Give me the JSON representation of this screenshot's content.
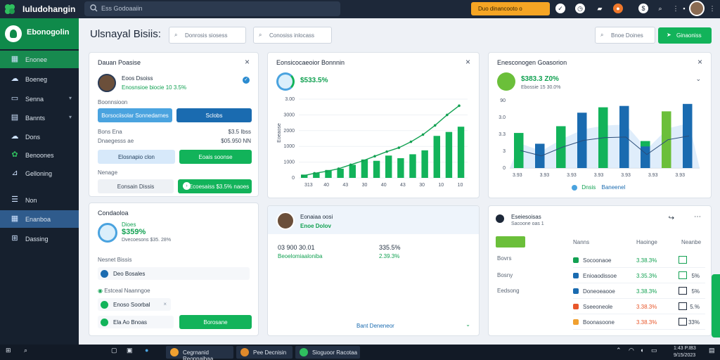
{
  "app": {
    "title": "Iuludohangin"
  },
  "topbar": {
    "search_placeholder": "Ess Godoaaiin",
    "promo_label": "Duo dinancooto o",
    "icons": [
      "check-icon",
      "clock-icon",
      "briefcase-icon",
      "fire-icon",
      "dollar-icon",
      "search-icon",
      "more-icon",
      "person-icon"
    ]
  },
  "sidebar": {
    "workspace": "Ebonogolin",
    "items": [
      {
        "label": "Enonee",
        "icon": "dashboard-icon"
      },
      {
        "label": "Boeneg",
        "icon": "cloud-icon"
      },
      {
        "label": "Senna",
        "icon": "inbox-icon"
      },
      {
        "label": "Bannts",
        "icon": "document-icon"
      },
      {
        "label": "Dons",
        "icon": "cloud-icon"
      },
      {
        "label": "Benoones",
        "icon": "leaf-icon"
      },
      {
        "label": "Gelloning",
        "icon": "bar-chart-icon"
      },
      {
        "label": "Non",
        "icon": "list-icon"
      },
      {
        "label": "Enanboa",
        "icon": "dashboard-icon"
      },
      {
        "label": "Dassing",
        "icon": "cart-icon"
      }
    ]
  },
  "header": {
    "title": "Ulsnayal Bisiis:",
    "filter_one": "Donrosis siosess",
    "filter_two": "Conosiss inlocass",
    "filter_three": "Bnoe Doines",
    "action_label": "Ginaoniss"
  },
  "profile_card": {
    "title": "Dauan Poasise",
    "name": "Eoos Dsoiss",
    "subtitle": "Enosnsioe biocie 10 3.5%",
    "section": "Boonnsioon",
    "btn_primary": "Borsociisolar Sonnedarnes",
    "btn_secondary": "Sclobs",
    "row1_label": "Bons Ena",
    "row1_value": "$3.5 Ibss",
    "row2_label": "Dnaegesss ae",
    "row2_value": "$05.950 NN",
    "btn_light": "Elosnapio clon",
    "btn_green": "Eoais soonse",
    "row3_label": "Nenage",
    "field_label": "Eonsain Dissis",
    "btn_toggle": "Ecoesaiss $3.5% naoes"
  },
  "contacts_card": {
    "title": "Condaoloa",
    "stat_label": "Dioes",
    "stat_value": "$359%",
    "stat_sub": "Dvecoesons $35. 28%",
    "section_one": "Nesnet Bissis",
    "section_two": "Estceal Naanngoe",
    "items": [
      "Deo Bosales",
      "Enoso Soorbal",
      "Ela Ao Bnoas"
    ],
    "btn_green": "Borosane"
  },
  "growth_card": {
    "title": "Eonsicocaeoior Bonnnin",
    "stat": "$533.5%"
  },
  "comparison_card": {
    "title": "Enesconogen Goasorion",
    "stat": "$383.3 Z0%",
    "stat_sub": "Ebossie  15 30.0%",
    "legend": [
      "Dnsis",
      "Baneenel"
    ]
  },
  "user_card": {
    "name": "Eonaiaa oosi",
    "subtitle": "Enoe Dolov",
    "left_value": "03 900 30.01",
    "left_sub": "Beoelomiaaloniba",
    "right_value": "335.5%",
    "right_sub": "2.39.3%",
    "footer": "Bant Deneneor"
  },
  "table_card": {
    "title": "Eseiesoisas",
    "subtitle": "Sacoone oas 1",
    "btn_green": "",
    "side_items": [
      "Bovrs",
      "Bosny",
      "Eedsong"
    ],
    "columns": [
      "Nanns",
      "Haoinge",
      "Neanbe"
    ],
    "rows": [
      {
        "name": "Socoonaoe",
        "change": "3.38.3%",
        "value": ""
      },
      {
        "name": "Enioaodissoe",
        "change": "3.35.3%",
        "value": "5%"
      },
      {
        "name": "Doneoeaooe",
        "change": "3.38.3%",
        "value": "5%"
      },
      {
        "name": "Sseeoneole",
        "change": "3.38.3%",
        "value": "5.%"
      },
      {
        "name": "Boonasoone",
        "change": "3.38.3%",
        "value": "33%"
      }
    ]
  },
  "taskbar": {
    "apps": [
      "Cegrnanid Reopnaibaa",
      "Pee Decnisin",
      "Sioguoor Racotaa"
    ],
    "time": "1:43 P.IB3",
    "date": "9/15/2023"
  },
  "colors": {
    "accent": "#12b35a",
    "sidebar": "#16202e",
    "blue": "#1a6bb0"
  },
  "chart_data": [
    {
      "type": "bar",
      "title": "Eonsicocaeoior Bonnnin",
      "ylabel": "Eoeaose",
      "yticks": [
        "3.00",
        "3000",
        "2000",
        "1000",
        "1000",
        "0"
      ],
      "xticks": [
        "313",
        "40",
        "43",
        "30",
        "40",
        "43",
        "30",
        "10",
        "10"
      ],
      "series": [
        {
          "values": [
            5,
            8,
            12,
            14,
            20,
            28,
            26,
            34,
            30,
            36,
            42,
            64,
            70,
            78
          ]
        },
        {
          "values": [
            3,
            7,
            10,
            14,
            20,
            26,
            33,
            40,
            46,
            55,
            66,
            80,
            96,
            110
          ],
          "type": "line"
        }
      ],
      "ylim": [
        0,
        120
      ]
    },
    {
      "type": "bar",
      "title": "Enesconogen Goasorion",
      "yticks": [
        "90",
        "3.0",
        "3.3",
        "3",
        "0"
      ],
      "xticks": [
        "3.93",
        "3.93",
        "3.93",
        "3.93",
        "3.93",
        "3.93",
        "3.93"
      ],
      "series": [
        {
          "name": "Dnsis",
          "values": [
            52,
            0,
            62,
            0,
            90,
            0,
            40,
            84,
            95
          ]
        },
        {
          "name": "Baneenel",
          "values": [
            0,
            36,
            0,
            82,
            0,
            92,
            32,
            0,
            0
          ]
        }
      ],
      "ylim": [
        0,
        100
      ]
    }
  ]
}
